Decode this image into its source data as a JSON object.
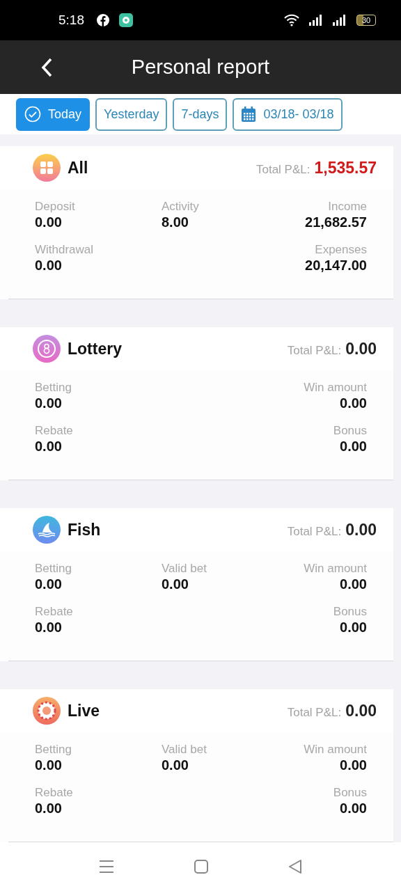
{
  "status_bar": {
    "time": "5:18",
    "battery": "30"
  },
  "header": {
    "title": "Personal report"
  },
  "filters": [
    {
      "label": "Today",
      "selected": true,
      "kind": "check"
    },
    {
      "label": "Yesterday",
      "selected": false,
      "kind": "plain"
    },
    {
      "label": "7-days",
      "selected": false,
      "kind": "plain"
    },
    {
      "label": "03/18- 03/18",
      "selected": false,
      "kind": "date"
    }
  ],
  "sections": [
    {
      "name": "All",
      "total_label": "Total P&L:",
      "total": "1,535.57",
      "highlight": true,
      "rows": [
        {
          "left": {
            "label": "Deposit",
            "value": "0.00"
          },
          "middle": {
            "label": "Activity",
            "value": "8.00"
          },
          "right": {
            "label": "Income",
            "value": "21,682.57"
          }
        },
        {
          "left": {
            "label": "Withdrawal",
            "value": "0.00"
          },
          "right": {
            "label": "Expenses",
            "value": "20,147.00"
          }
        }
      ]
    },
    {
      "name": "Lottery",
      "total_label": "Total P&L:",
      "total": "0.00",
      "highlight": false,
      "rows": [
        {
          "left": {
            "label": "Betting",
            "value": "0.00"
          },
          "right": {
            "label": "Win amount",
            "value": "0.00"
          }
        },
        {
          "left": {
            "label": "Rebate",
            "value": "0.00"
          },
          "right": {
            "label": "Bonus",
            "value": "0.00"
          }
        }
      ]
    },
    {
      "name": "Fish",
      "total_label": "Total P&L:",
      "total": "0.00",
      "highlight": false,
      "rows": [
        {
          "left": {
            "label": "Betting",
            "value": "0.00"
          },
          "middle": {
            "label": "Valid bet",
            "value": "0.00"
          },
          "right": {
            "label": "Win amount",
            "value": "0.00"
          }
        },
        {
          "left": {
            "label": "Rebate",
            "value": "0.00"
          },
          "right": {
            "label": "Bonus",
            "value": "0.00"
          }
        }
      ]
    },
    {
      "name": "Live",
      "total_label": "Total P&L:",
      "total": "0.00",
      "highlight": false,
      "rows": [
        {
          "left": {
            "label": "Betting",
            "value": "0.00"
          },
          "middle": {
            "label": "Valid bet",
            "value": "0.00"
          },
          "right": {
            "label": "Win amount",
            "value": "0.00"
          }
        },
        {
          "left": {
            "label": "Rebate",
            "value": "0.00"
          },
          "right": {
            "label": "Bonus",
            "value": "0.00"
          }
        }
      ]
    }
  ]
}
